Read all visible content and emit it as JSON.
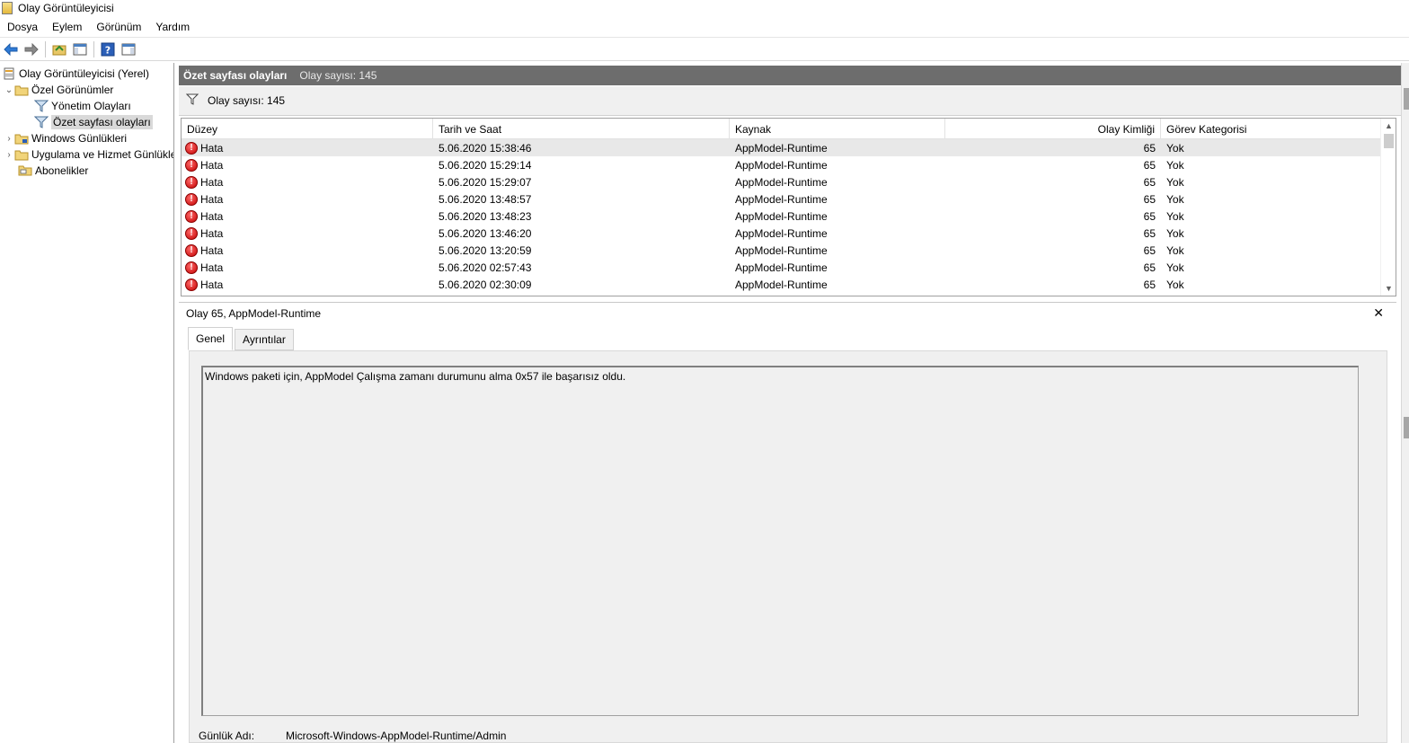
{
  "window": {
    "title": "Olay Görüntüleyicisi"
  },
  "menu": [
    "Dosya",
    "Eylem",
    "Görünüm",
    "Yardım"
  ],
  "toolbar": {
    "buttons": [
      "back-arrow-icon",
      "forward-arrow-icon",
      "open-folder-icon",
      "show-hide-tree-icon",
      "help-icon",
      "show-hide-action-pane-icon"
    ]
  },
  "tree": {
    "items": [
      {
        "label": "Olay Görüntüleyicisi (Yerel)",
        "icon": "event-viewer-icon"
      },
      {
        "label": "Özel Görünümler",
        "icon": "folder-icon",
        "expander": "⌄"
      },
      {
        "label": "Yönetim Olayları",
        "icon": "filter-icon"
      },
      {
        "label": "Özet sayfası olayları",
        "icon": "filter-icon",
        "selected": true
      },
      {
        "label": "Windows Günlükleri",
        "icon": "folder-icon",
        "expander": "›"
      },
      {
        "label": "Uygulama ve Hizmet Günlükleri",
        "icon": "folder-icon",
        "expander": "›"
      },
      {
        "label": "Abonelikler",
        "icon": "subscriptions-icon"
      }
    ]
  },
  "section": {
    "title": "Özet sayfası olayları",
    "count_label": "Olay sayısı: 145"
  },
  "filter": {
    "text": "Olay sayısı: 145"
  },
  "grid": {
    "columns": [
      "Düzey",
      "Tarih ve Saat",
      "Kaynak",
      "Olay Kimliği",
      "Görev Kategorisi"
    ],
    "rows": [
      {
        "level": "Hata",
        "datetime": "5.06.2020 15:38:46",
        "source": "AppModel-Runtime",
        "id": "65",
        "category": "Yok"
      },
      {
        "level": "Hata",
        "datetime": "5.06.2020 15:29:14",
        "source": "AppModel-Runtime",
        "id": "65",
        "category": "Yok"
      },
      {
        "level": "Hata",
        "datetime": "5.06.2020 15:29:07",
        "source": "AppModel-Runtime",
        "id": "65",
        "category": "Yok"
      },
      {
        "level": "Hata",
        "datetime": "5.06.2020 13:48:57",
        "source": "AppModel-Runtime",
        "id": "65",
        "category": "Yok"
      },
      {
        "level": "Hata",
        "datetime": "5.06.2020 13:48:23",
        "source": "AppModel-Runtime",
        "id": "65",
        "category": "Yok"
      },
      {
        "level": "Hata",
        "datetime": "5.06.2020 13:46:20",
        "source": "AppModel-Runtime",
        "id": "65",
        "category": "Yok"
      },
      {
        "level": "Hata",
        "datetime": "5.06.2020 13:20:59",
        "source": "AppModel-Runtime",
        "id": "65",
        "category": "Yok"
      },
      {
        "level": "Hata",
        "datetime": "5.06.2020 02:57:43",
        "source": "AppModel-Runtime",
        "id": "65",
        "category": "Yok"
      },
      {
        "level": "Hata",
        "datetime": "5.06.2020 02:30:09",
        "source": "AppModel-Runtime",
        "id": "65",
        "category": "Yok"
      }
    ]
  },
  "detail": {
    "title": "Olay 65, AppModel-Runtime",
    "close_label": "✕",
    "tabs": [
      "Genel",
      "Ayrıntılar"
    ],
    "description": "Windows paketi için, AppModel Çalışma zamanı durumunu alma 0x57 ile başarısız oldu.",
    "log_name_label": "Günlük Adı:",
    "log_name_value": "Microsoft-Windows-AppModel-Runtime/Admin"
  },
  "colors": {
    "section_header": "#6d6d6d",
    "error_red": "#c40000",
    "selected_bg": "#d9d9d9"
  }
}
